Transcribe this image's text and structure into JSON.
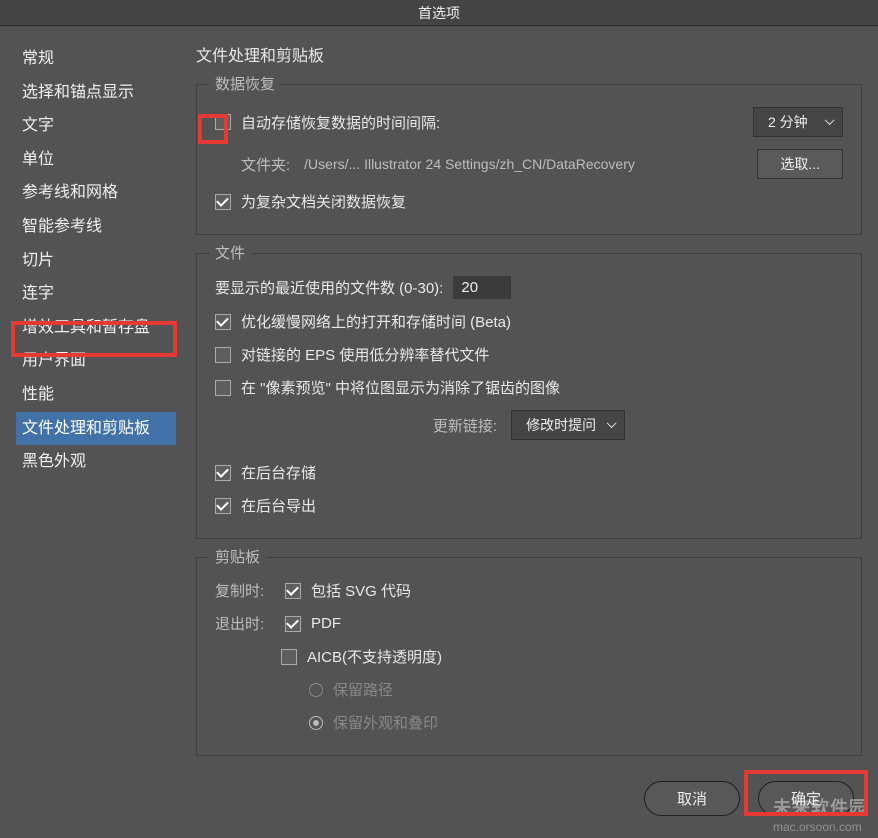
{
  "window": {
    "title": "首选项"
  },
  "sidebar": {
    "items": [
      {
        "label": "常规"
      },
      {
        "label": "选择和锚点显示"
      },
      {
        "label": "文字"
      },
      {
        "label": "单位"
      },
      {
        "label": "参考线和网格"
      },
      {
        "label": "智能参考线"
      },
      {
        "label": "切片"
      },
      {
        "label": "连字"
      },
      {
        "label": "增效工具和暂存盘"
      },
      {
        "label": "用户界面"
      },
      {
        "label": "性能"
      },
      {
        "label": "文件处理和剪贴板",
        "selected": true
      },
      {
        "label": "黑色外观"
      }
    ]
  },
  "page": {
    "title": "文件处理和剪贴板"
  },
  "sections": {
    "recovery": {
      "title": "数据恢复",
      "autosave_label": "自动存储恢复数据的时间间隔:",
      "interval_value": "2 分钟",
      "folder_label": "文件夹:",
      "folder_path": "/Users/... Illustrator 24 Settings/zh_CN/DataRecovery",
      "choose_btn": "选取...",
      "disable_complex_label": "为复杂文档关闭数据恢复"
    },
    "files": {
      "title": "文件",
      "recent_label": "要显示的最近使用的文件数 (0-30):",
      "recent_value": "20",
      "optimize_label": "优化缓慢网络上的打开和存储时间 (Beta)",
      "eps_lowres_label": "对链接的 EPS 使用低分辨率替代文件",
      "pixel_preview_label": "在 \"像素预览\" 中将位图显示为消除了锯齿的图像",
      "update_links_label": "更新链接:",
      "update_links_value": "修改时提问",
      "bg_save_label": "在后台存储",
      "bg_export_label": "在后台导出"
    },
    "clipboard": {
      "title": "剪贴板",
      "copy_label": "复制时:",
      "svg_label": "包括 SVG 代码",
      "quit_label": "退出时:",
      "pdf_label": "PDF",
      "aicb_label": "AICB(不支持透明度)",
      "preserve_paths_label": "保留路径",
      "preserve_appearance_label": "保留外观和叠印"
    }
  },
  "footer": {
    "cancel": "取消",
    "ok": "确定"
  },
  "watermark": {
    "line1": "未来软件园",
    "line2": "mac.orsoon.com"
  }
}
